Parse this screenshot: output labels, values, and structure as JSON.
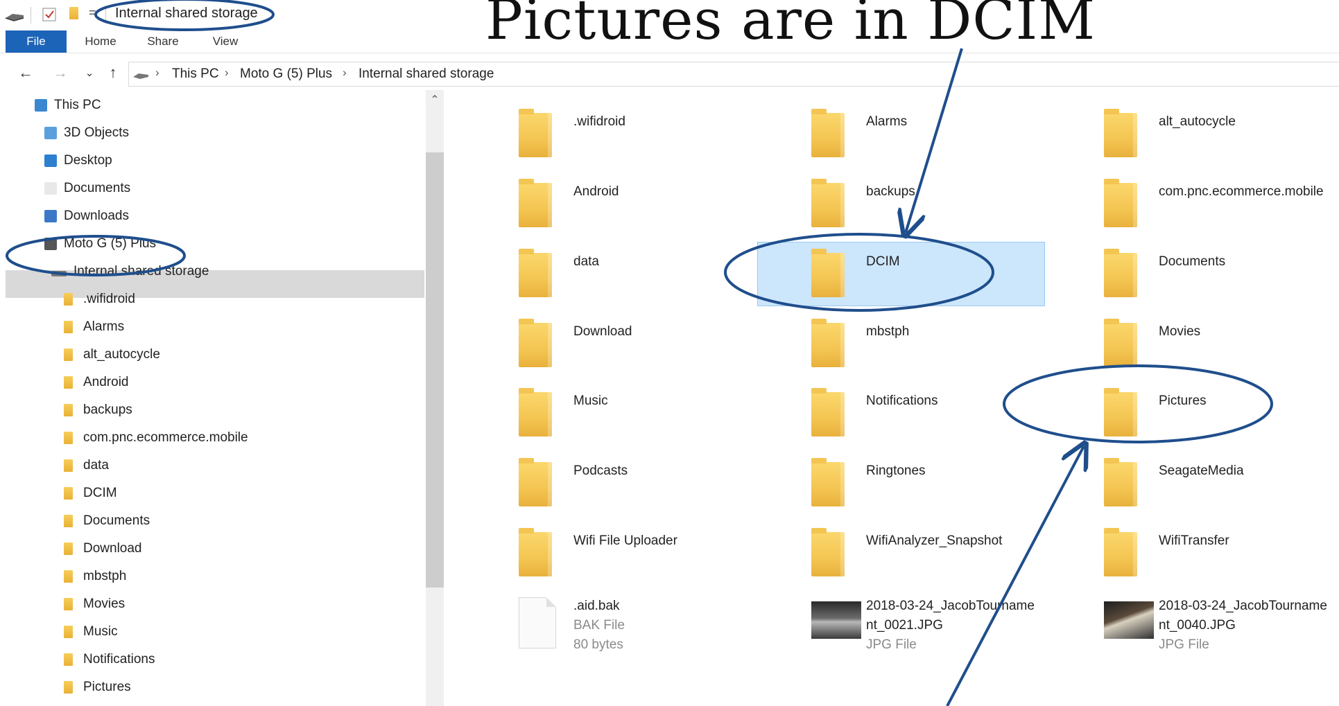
{
  "annotation": {
    "heading": "Pictures are in DCIM",
    "ink_color": "#1f4e8c"
  },
  "window": {
    "title": "Internal shared storage",
    "accent_color": "#1c64b8",
    "selection_color": "#cce6fb"
  },
  "ribbon": {
    "tabs": [
      "File",
      "Home",
      "Share",
      "View"
    ]
  },
  "address": {
    "breadcrumbs": [
      "This PC",
      "Moto G (5) Plus",
      "Internal shared storage"
    ]
  },
  "nav_pane": {
    "items": [
      {
        "label": "This PC",
        "icon": "this-pc-icon"
      },
      {
        "label": "3D Objects",
        "icon": "3d-objects-icon"
      },
      {
        "label": "Desktop",
        "icon": "desktop-icon"
      },
      {
        "label": "Documents",
        "icon": "documents-icon"
      },
      {
        "label": "Downloads",
        "icon": "downloads-icon"
      },
      {
        "label": "Moto G (5) Plus",
        "icon": "phone-icon"
      },
      {
        "label": "Internal shared storage",
        "icon": "drive-icon",
        "selected": true
      },
      {
        "label": ".wifidroid",
        "icon": "folder-icon"
      },
      {
        "label": "Alarms",
        "icon": "folder-icon"
      },
      {
        "label": "alt_autocycle",
        "icon": "folder-icon"
      },
      {
        "label": "Android",
        "icon": "folder-icon"
      },
      {
        "label": "backups",
        "icon": "folder-icon"
      },
      {
        "label": "com.pnc.ecommerce.mobile",
        "icon": "folder-icon"
      },
      {
        "label": "data",
        "icon": "folder-icon"
      },
      {
        "label": "DCIM",
        "icon": "folder-icon"
      },
      {
        "label": "Documents",
        "icon": "folder-icon"
      },
      {
        "label": "Download",
        "icon": "folder-icon"
      },
      {
        "label": "mbstph",
        "icon": "folder-icon"
      },
      {
        "label": "Movies",
        "icon": "folder-icon"
      },
      {
        "label": "Music",
        "icon": "folder-icon"
      },
      {
        "label": "Notifications",
        "icon": "folder-icon"
      },
      {
        "label": "Pictures",
        "icon": "folder-icon"
      }
    ]
  },
  "content": {
    "items": [
      {
        "name": ".wifidroid",
        "kind": "folder"
      },
      {
        "name": "Alarms",
        "kind": "folder"
      },
      {
        "name": "alt_autocycle",
        "kind": "folder"
      },
      {
        "name": "Android",
        "kind": "folder"
      },
      {
        "name": "backups",
        "kind": "folder"
      },
      {
        "name": "com.pnc.ecommerce.mobile",
        "kind": "folder"
      },
      {
        "name": "data",
        "kind": "folder"
      },
      {
        "name": "DCIM",
        "kind": "folder",
        "selected": true
      },
      {
        "name": "Documents",
        "kind": "folder"
      },
      {
        "name": "Download",
        "kind": "folder"
      },
      {
        "name": "mbstph",
        "kind": "folder"
      },
      {
        "name": "Movies",
        "kind": "folder"
      },
      {
        "name": "Music",
        "kind": "folder"
      },
      {
        "name": "Notifications",
        "kind": "folder"
      },
      {
        "name": "Pictures",
        "kind": "folder"
      },
      {
        "name": "Podcasts",
        "kind": "folder"
      },
      {
        "name": "Ringtones",
        "kind": "folder"
      },
      {
        "name": "SeagateMedia",
        "kind": "folder"
      },
      {
        "name": "Wifi File Uploader",
        "kind": "folder"
      },
      {
        "name": "WifiAnalyzer_Snapshot",
        "kind": "folder"
      },
      {
        "name": "WifiTransfer",
        "kind": "folder"
      },
      {
        "name": ".aid.bak",
        "kind": "file",
        "type": "BAK File",
        "size": "80 bytes"
      },
      {
        "name_line1": "2018-03-24_JacobTourname",
        "name_line2": "nt_0021.JPG",
        "kind": "image",
        "type": "JPG File"
      },
      {
        "name_line1": "2018-03-24_JacobTourname",
        "name_line2": "nt_0040.JPG",
        "kind": "image",
        "type": "JPG File"
      }
    ]
  }
}
